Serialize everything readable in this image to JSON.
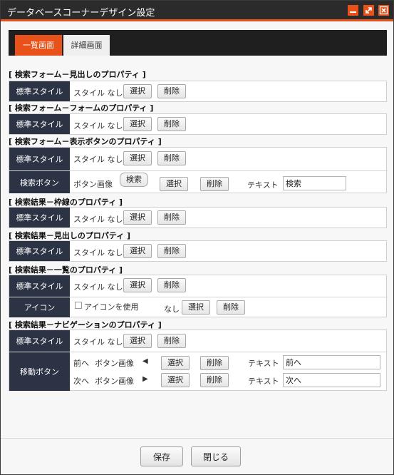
{
  "window": {
    "title": "データベースコーナーデザイン設定",
    "accent": "#e8521a"
  },
  "tabs": [
    {
      "label": "一覧画面",
      "active": true
    },
    {
      "label": "詳細画面",
      "active": false
    }
  ],
  "sections": {
    "s1": {
      "title": "[ 検索フォーム－見出しのプロパティ ]",
      "label": "標準スタイル",
      "value": "スタイル なし"
    },
    "s2": {
      "title": "[ 検索フォーム－フォームのプロパティ ]",
      "label": "標準スタイル",
      "value": "スタイル なし"
    },
    "s3": {
      "title": "[ 検索フォーム－表示ボタンのプロパティ ]",
      "label": "標準スタイル",
      "value": "スタイル なし",
      "button_row": {
        "label": "検索ボタン",
        "image_text": "ボタン画像",
        "preview": "検索",
        "text_label": "テキスト",
        "text_value": "検索"
      }
    },
    "s4": {
      "title": "[ 検索結果－枠線のプロパティ ]",
      "label": "標準スタイル",
      "value": "スタイル なし"
    },
    "s5": {
      "title": "[ 検索結果－見出しのプロパティ ]",
      "label": "標準スタイル",
      "value": "スタイル なし"
    },
    "s6": {
      "title": "[ 検索結果－一覧のプロパティ ]",
      "label": "標準スタイル",
      "value": "スタイル なし",
      "icon_row": {
        "label": "アイコン",
        "checkbox_label": "アイコンを使用",
        "checked": false,
        "none_text": "なし"
      }
    },
    "s7": {
      "title": "[ 検索結果－ナビゲーションのプロパティ ]",
      "label": "標準スタイル",
      "value": "スタイル なし",
      "move_row": {
        "label": "移動ボタン",
        "prev": {
          "dir": "前へ",
          "image_text": "ボタン画像",
          "arrow": "◀",
          "text_label": "テキスト",
          "text_value": "前へ"
        },
        "next": {
          "dir": "次へ",
          "image_text": "ボタン画像",
          "arrow": "▶",
          "text_label": "テキスト",
          "text_value": "次へ"
        }
      }
    }
  },
  "buttons": {
    "select": "選択",
    "delete": "削除"
  },
  "footer": {
    "save": "保存",
    "close": "閉じる"
  }
}
